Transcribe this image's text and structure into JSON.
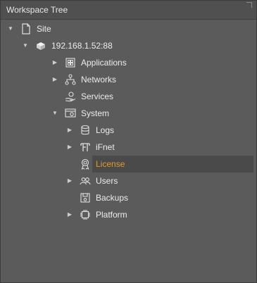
{
  "panel": {
    "title": "Workspace Tree"
  },
  "tree": {
    "site": {
      "label": "Site",
      "icon": "page-icon",
      "expanded": true
    },
    "device": {
      "label": "192.168.1.52:88",
      "icon": "device-icon",
      "expanded": true
    },
    "applications": {
      "label": "Applications",
      "icon": "applications-icon",
      "expanded": false
    },
    "networks": {
      "label": "Networks",
      "icon": "network-icon",
      "expanded": false
    },
    "services": {
      "label": "Services",
      "icon": "services-icon"
    },
    "system": {
      "label": "System",
      "icon": "system-icon",
      "expanded": true
    },
    "logs": {
      "label": "Logs",
      "icon": "database-icon",
      "expanded": false
    },
    "ifnet": {
      "label": "iFnet",
      "icon": "ifnet-icon",
      "expanded": false
    },
    "license": {
      "label": "License",
      "icon": "license-icon",
      "selected": true
    },
    "users": {
      "label": "Users",
      "icon": "users-icon",
      "expanded": false
    },
    "backups": {
      "label": "Backups",
      "icon": "backups-icon"
    },
    "platform": {
      "label": "Platform",
      "icon": "chip-icon",
      "expanded": false
    }
  },
  "colors": {
    "selected_text": "#e39a2b",
    "selected_row": "#4a4a4a",
    "panel_bg": "#5b5b5b",
    "header_bg": "#505050"
  }
}
